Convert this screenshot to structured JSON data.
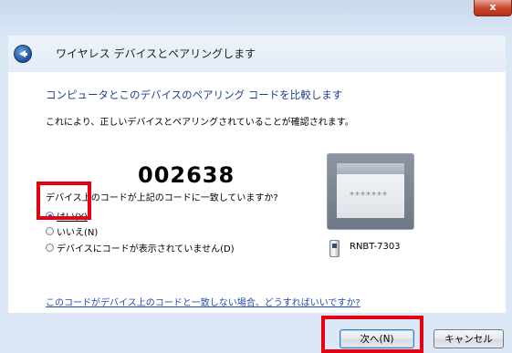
{
  "window": {
    "title": "ワイヤレス デバイスとペアリングします",
    "close_label": "x"
  },
  "main": {
    "heading": "コンピュータとこのデバイスのペアリング コードを比較します",
    "description": "これにより、正しいデバイスとペアリングされていることが確認されます。",
    "pairing_code": "002638",
    "question": "デバイス上のコードが上記のコードに一致していますか?",
    "options": [
      {
        "label": "はい(Y)",
        "selected": true
      },
      {
        "label": "いいえ(N)",
        "selected": false
      },
      {
        "label": "デバイスにコードが表示されていません(D)",
        "selected": false
      }
    ],
    "help_link": "このコードがデバイス上のコードと一致しない場合、どうすればいいですか?"
  },
  "device": {
    "screen_text": "*******",
    "name": "RNBT-7303"
  },
  "buttons": {
    "next": "次へ(N)",
    "cancel": "キャンセル"
  },
  "colors": {
    "heading": "#1e3f8f",
    "link": "#1f4db0",
    "highlight": "#e60012"
  }
}
